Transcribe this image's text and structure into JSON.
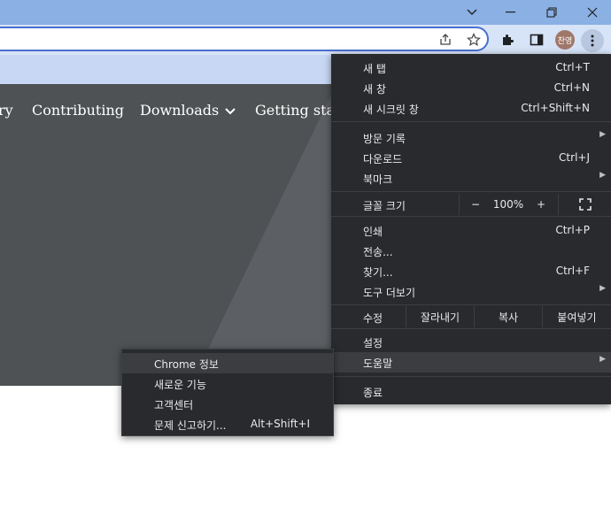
{
  "window": {
    "minimize_icon": "chevron-down-icon",
    "restore_icon": "restore-icon",
    "close_icon": "close-icon"
  },
  "toolbar": {
    "profile_label": "찬영"
  },
  "page": {
    "nav": [
      "ry",
      "Contributing",
      "Downloads",
      "Getting star"
    ]
  },
  "menu": {
    "new_tab": {
      "label": "새 탭",
      "shortcut": "Ctrl+T"
    },
    "new_window": {
      "label": "새 창",
      "shortcut": "Ctrl+N"
    },
    "incognito": {
      "label": "새 시크릿 창",
      "shortcut": "Ctrl+Shift+N"
    },
    "history": {
      "label": "방문 기록"
    },
    "downloads": {
      "label": "다운로드",
      "shortcut": "Ctrl+J"
    },
    "bookmarks": {
      "label": "북마크"
    },
    "zoom": {
      "label": "글꼴 크기",
      "minus": "−",
      "value": "100%",
      "plus": "+"
    },
    "print": {
      "label": "인쇄",
      "shortcut": "Ctrl+P"
    },
    "cast": {
      "label": "전송..."
    },
    "find": {
      "label": "찾기...",
      "shortcut": "Ctrl+F"
    },
    "more_tools": {
      "label": "도구 더보기"
    },
    "edit": {
      "label": "수정",
      "cut": "잘라내기",
      "copy": "복사",
      "paste": "붙여넣기"
    },
    "settings": {
      "label": "설정"
    },
    "help": {
      "label": "도움말"
    },
    "exit": {
      "label": "종료"
    }
  },
  "help_submenu": {
    "about": {
      "label": "Chrome 정보"
    },
    "whats_new": {
      "label": "새로운 기능"
    },
    "help_center": {
      "label": "고객센터"
    },
    "report": {
      "label": "문제 신고하기...",
      "shortcut": "Alt+Shift+I"
    }
  },
  "colors": {
    "menu_bg": "#292a2d",
    "menu_text": "#e8eaed",
    "highlight": "#3c3d40",
    "titlebar": "#8ab0e4"
  }
}
